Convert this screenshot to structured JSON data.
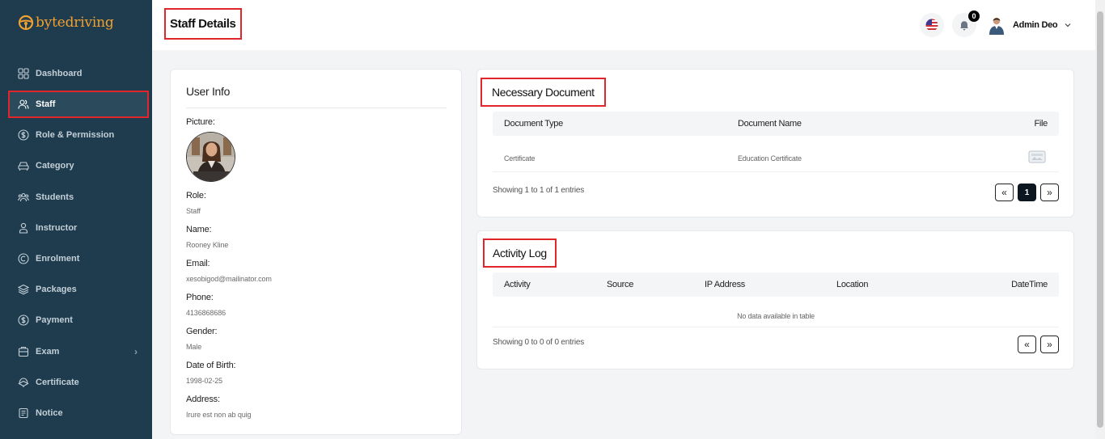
{
  "brand": {
    "part1": "byte",
    "part2": "driving"
  },
  "sidebar": {
    "items": [
      {
        "label": "Dashboard",
        "icon": "grid-icon"
      },
      {
        "label": "Staff",
        "icon": "users-icon",
        "active": true
      },
      {
        "label": "Role & Permission",
        "icon": "dollar-icon"
      },
      {
        "label": "Category",
        "icon": "car-icon"
      },
      {
        "label": "Students",
        "icon": "students-icon"
      },
      {
        "label": "Instructor",
        "icon": "user-icon"
      },
      {
        "label": "Enrolment",
        "icon": "copyright-icon"
      },
      {
        "label": "Packages",
        "icon": "layers-icon"
      },
      {
        "label": "Payment",
        "icon": "dollar-icon"
      },
      {
        "label": "Exam",
        "icon": "exam-icon",
        "has_children": true
      },
      {
        "label": "Certificate",
        "icon": "certificate-icon"
      },
      {
        "label": "Notice",
        "icon": "notice-icon"
      }
    ],
    "colors": {
      "background": "#1f3c4e",
      "active_border": "#e0262a",
      "brand": "#f0a030"
    }
  },
  "header": {
    "title": "Staff Details",
    "notification_count": "0",
    "user_name": "Admin Deo"
  },
  "user_info": {
    "title": "User Info",
    "picture_label": "Picture:",
    "fields": [
      {
        "label": "Role:",
        "value": "Staff"
      },
      {
        "label": "Name:",
        "value": "Rooney Kline"
      },
      {
        "label": "Email:",
        "value": "xesobigod@mailinator.com"
      },
      {
        "label": "Phone:",
        "value": "4136868686"
      },
      {
        "label": "Gender:",
        "value": "Male"
      },
      {
        "label": "Date of Birth:",
        "value": "1998-02-25"
      },
      {
        "label": "Address:",
        "value": "Irure est non ab quig"
      }
    ]
  },
  "documents": {
    "title": "Necessary Document",
    "columns": [
      "Document Type",
      "Document Name",
      "File"
    ],
    "rows": [
      {
        "type": "Certificate",
        "name": "Education Certificate",
        "file_icon": "document-image-icon"
      }
    ],
    "showing": "Showing 1 to 1 of 1 entries",
    "pagination": {
      "prev": "«",
      "current": "1",
      "next": "»"
    }
  },
  "activity": {
    "title": "Activity Log",
    "columns": [
      "Activity",
      "Source",
      "IP Address",
      "Location",
      "DateTime"
    ],
    "empty": "No data available in table",
    "showing": "Showing 0 to 0 of 0 entries",
    "pagination": {
      "prev": "«",
      "next": "»"
    }
  }
}
